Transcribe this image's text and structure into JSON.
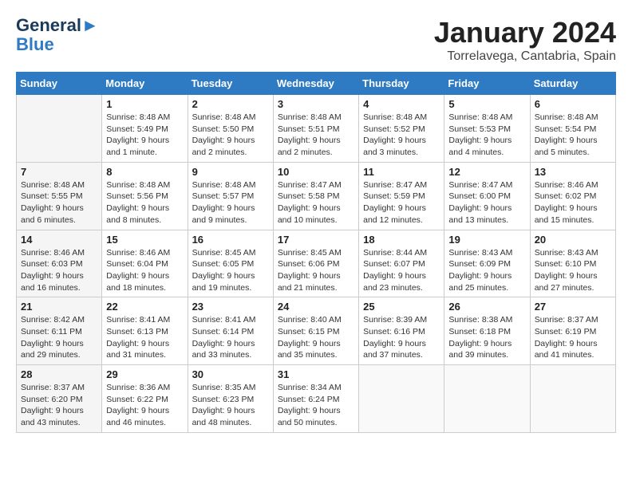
{
  "logo": {
    "line1": "General",
    "line2": "Blue"
  },
  "title": "January 2024",
  "subtitle": "Torrelavega, Cantabria, Spain",
  "headers": [
    "Sunday",
    "Monday",
    "Tuesday",
    "Wednesday",
    "Thursday",
    "Friday",
    "Saturday"
  ],
  "weeks": [
    [
      {
        "day": "",
        "info": ""
      },
      {
        "day": "1",
        "info": "Sunrise: 8:48 AM\nSunset: 5:49 PM\nDaylight: 9 hours\nand 1 minute."
      },
      {
        "day": "2",
        "info": "Sunrise: 8:48 AM\nSunset: 5:50 PM\nDaylight: 9 hours\nand 2 minutes."
      },
      {
        "day": "3",
        "info": "Sunrise: 8:48 AM\nSunset: 5:51 PM\nDaylight: 9 hours\nand 2 minutes."
      },
      {
        "day": "4",
        "info": "Sunrise: 8:48 AM\nSunset: 5:52 PM\nDaylight: 9 hours\nand 3 minutes."
      },
      {
        "day": "5",
        "info": "Sunrise: 8:48 AM\nSunset: 5:53 PM\nDaylight: 9 hours\nand 4 minutes."
      },
      {
        "day": "6",
        "info": "Sunrise: 8:48 AM\nSunset: 5:54 PM\nDaylight: 9 hours\nand 5 minutes."
      }
    ],
    [
      {
        "day": "7",
        "info": "Sunrise: 8:48 AM\nSunset: 5:55 PM\nDaylight: 9 hours\nand 6 minutes."
      },
      {
        "day": "8",
        "info": "Sunrise: 8:48 AM\nSunset: 5:56 PM\nDaylight: 9 hours\nand 8 minutes."
      },
      {
        "day": "9",
        "info": "Sunrise: 8:48 AM\nSunset: 5:57 PM\nDaylight: 9 hours\nand 9 minutes."
      },
      {
        "day": "10",
        "info": "Sunrise: 8:47 AM\nSunset: 5:58 PM\nDaylight: 9 hours\nand 10 minutes."
      },
      {
        "day": "11",
        "info": "Sunrise: 8:47 AM\nSunset: 5:59 PM\nDaylight: 9 hours\nand 12 minutes."
      },
      {
        "day": "12",
        "info": "Sunrise: 8:47 AM\nSunset: 6:00 PM\nDaylight: 9 hours\nand 13 minutes."
      },
      {
        "day": "13",
        "info": "Sunrise: 8:46 AM\nSunset: 6:02 PM\nDaylight: 9 hours\nand 15 minutes."
      }
    ],
    [
      {
        "day": "14",
        "info": "Sunrise: 8:46 AM\nSunset: 6:03 PM\nDaylight: 9 hours\nand 16 minutes."
      },
      {
        "day": "15",
        "info": "Sunrise: 8:46 AM\nSunset: 6:04 PM\nDaylight: 9 hours\nand 18 minutes."
      },
      {
        "day": "16",
        "info": "Sunrise: 8:45 AM\nSunset: 6:05 PM\nDaylight: 9 hours\nand 19 minutes."
      },
      {
        "day": "17",
        "info": "Sunrise: 8:45 AM\nSunset: 6:06 PM\nDaylight: 9 hours\nand 21 minutes."
      },
      {
        "day": "18",
        "info": "Sunrise: 8:44 AM\nSunset: 6:07 PM\nDaylight: 9 hours\nand 23 minutes."
      },
      {
        "day": "19",
        "info": "Sunrise: 8:43 AM\nSunset: 6:09 PM\nDaylight: 9 hours\nand 25 minutes."
      },
      {
        "day": "20",
        "info": "Sunrise: 8:43 AM\nSunset: 6:10 PM\nDaylight: 9 hours\nand 27 minutes."
      }
    ],
    [
      {
        "day": "21",
        "info": "Sunrise: 8:42 AM\nSunset: 6:11 PM\nDaylight: 9 hours\nand 29 minutes."
      },
      {
        "day": "22",
        "info": "Sunrise: 8:41 AM\nSunset: 6:13 PM\nDaylight: 9 hours\nand 31 minutes."
      },
      {
        "day": "23",
        "info": "Sunrise: 8:41 AM\nSunset: 6:14 PM\nDaylight: 9 hours\nand 33 minutes."
      },
      {
        "day": "24",
        "info": "Sunrise: 8:40 AM\nSunset: 6:15 PM\nDaylight: 9 hours\nand 35 minutes."
      },
      {
        "day": "25",
        "info": "Sunrise: 8:39 AM\nSunset: 6:16 PM\nDaylight: 9 hours\nand 37 minutes."
      },
      {
        "day": "26",
        "info": "Sunrise: 8:38 AM\nSunset: 6:18 PM\nDaylight: 9 hours\nand 39 minutes."
      },
      {
        "day": "27",
        "info": "Sunrise: 8:37 AM\nSunset: 6:19 PM\nDaylight: 9 hours\nand 41 minutes."
      }
    ],
    [
      {
        "day": "28",
        "info": "Sunrise: 8:37 AM\nSunset: 6:20 PM\nDaylight: 9 hours\nand 43 minutes."
      },
      {
        "day": "29",
        "info": "Sunrise: 8:36 AM\nSunset: 6:22 PM\nDaylight: 9 hours\nand 46 minutes."
      },
      {
        "day": "30",
        "info": "Sunrise: 8:35 AM\nSunset: 6:23 PM\nDaylight: 9 hours\nand 48 minutes."
      },
      {
        "day": "31",
        "info": "Sunrise: 8:34 AM\nSunset: 6:24 PM\nDaylight: 9 hours\nand 50 minutes."
      },
      {
        "day": "",
        "info": ""
      },
      {
        "day": "",
        "info": ""
      },
      {
        "day": "",
        "info": ""
      }
    ]
  ]
}
